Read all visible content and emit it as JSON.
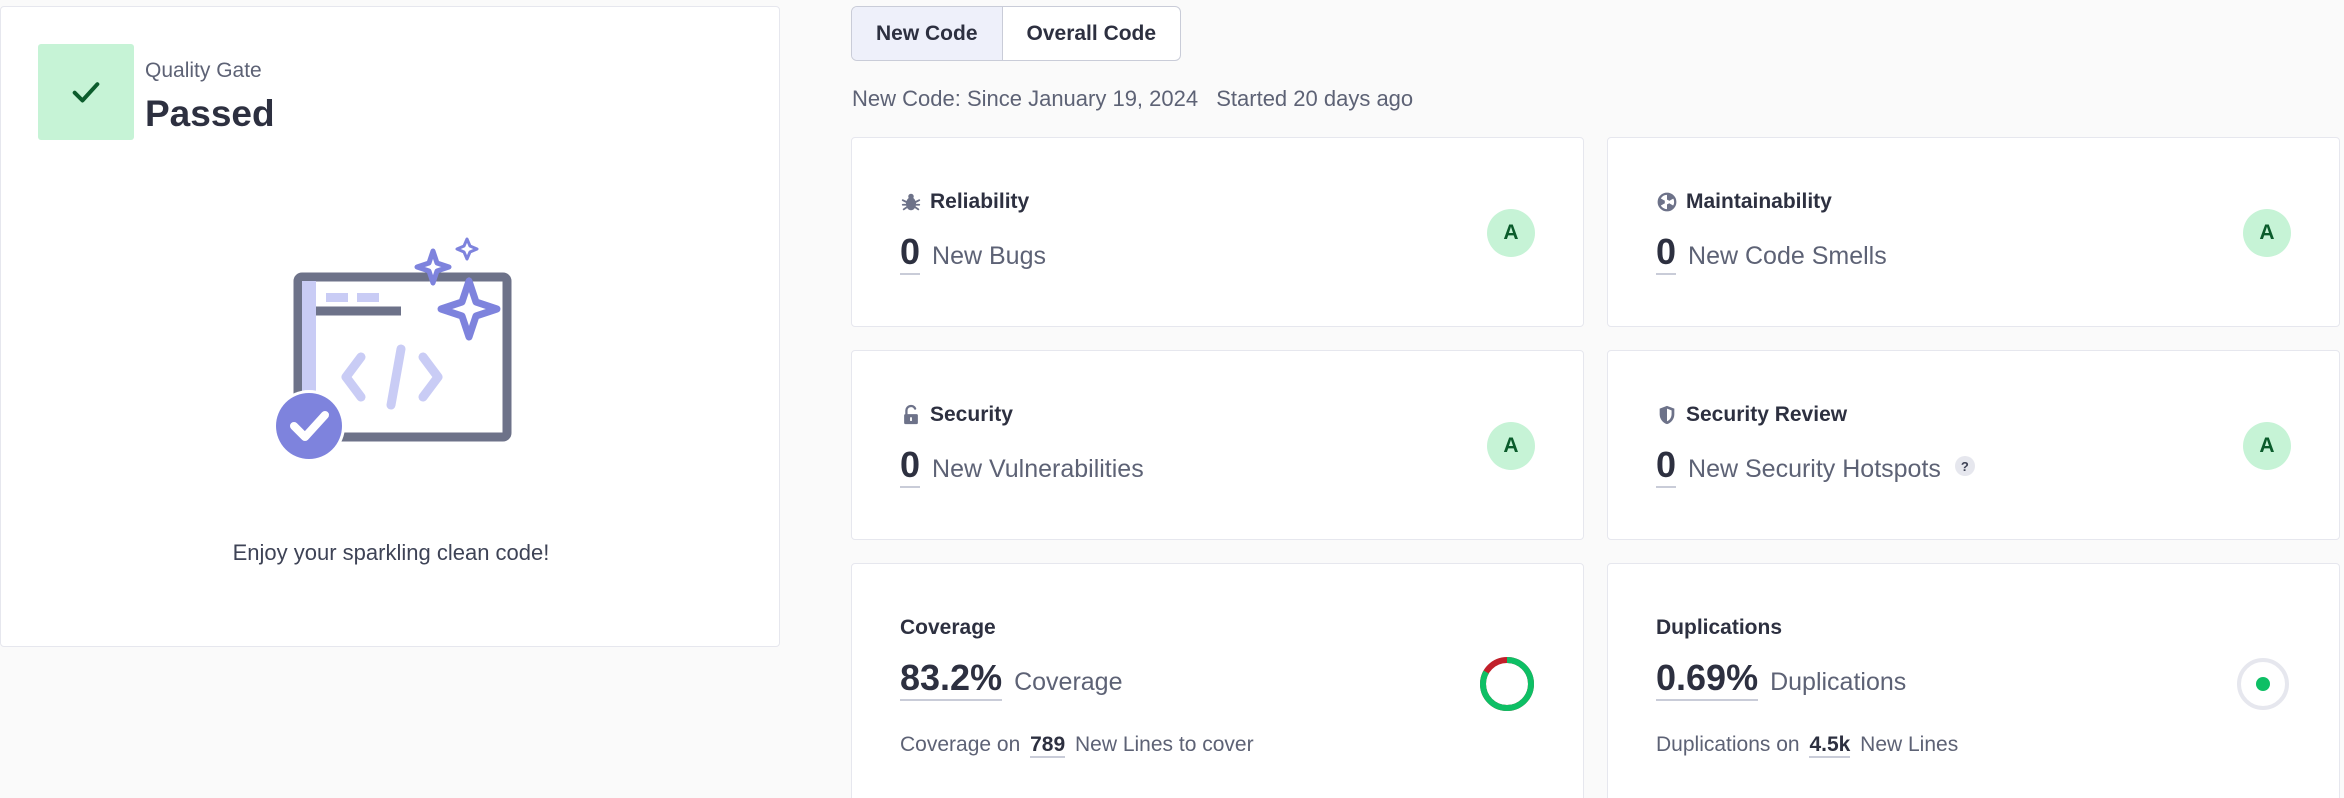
{
  "quality_gate": {
    "label": "Quality Gate",
    "status": "Passed",
    "message": "Enjoy your sparkling clean code!"
  },
  "toggle": {
    "new_code": "New Code",
    "overall_code": "Overall Code",
    "active": "New Code"
  },
  "period": {
    "since": "New Code: Since January 19, 2024",
    "started": "Started 20 days ago"
  },
  "metrics": {
    "reliability": {
      "title": "Reliability",
      "value": "0",
      "unit": "New Bugs",
      "rating": "A",
      "icon": "bug-icon"
    },
    "maintainability": {
      "title": "Maintainability",
      "value": "0",
      "unit": "New Code Smells",
      "rating": "A",
      "icon": "code-smell-icon"
    },
    "security": {
      "title": "Security",
      "value": "0",
      "unit": "New Vulnerabilities",
      "rating": "A",
      "icon": "lock-open-icon"
    },
    "security_review": {
      "title": "Security Review",
      "value": "0",
      "unit": "New Security Hotspots",
      "rating": "A",
      "icon": "shield-icon",
      "help": "?"
    },
    "coverage": {
      "title": "Coverage",
      "value": "83.2%",
      "unit": "Coverage",
      "percent": 83.2,
      "sub_prefix": "Coverage on",
      "sub_value": "789",
      "sub_suffix": "New Lines to cover"
    },
    "duplications": {
      "title": "Duplications",
      "value": "0.69%",
      "unit": "Duplications",
      "percent": 0.69,
      "sub_prefix": "Duplications on",
      "sub_value": "4.5k",
      "sub_suffix": "New Lines"
    }
  },
  "colors": {
    "rating_bg": "#c6f3d6",
    "rating_text": "#0b5c2c",
    "coverage_good": "#0ebf65",
    "coverage_bad": "#c11f2a",
    "illustration": "#7e83dd",
    "illustration_frame": "#6d7289"
  }
}
